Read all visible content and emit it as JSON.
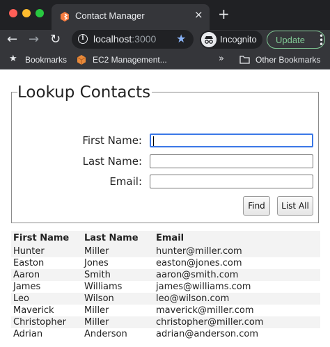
{
  "browser": {
    "tab_title": "Contact Manager",
    "tab_close": "×",
    "new_tab": "+",
    "url_host": "localhost",
    "url_port": ":3000",
    "incognito_label": "Incognito",
    "update_label": "Update",
    "bookmarks": {
      "bookmarks_label": "Bookmarks",
      "ec2_label": "EC2 Management...",
      "overflow": "»",
      "other_label": "Other Bookmarks"
    },
    "colors": {
      "frame": "#202124",
      "toolbar": "#35363a",
      "accent": "#8ab4f8",
      "update": "#81c995"
    }
  },
  "lookup": {
    "legend": "Lookup Contacts",
    "first_name_label": "First Name:",
    "last_name_label": "Last Name:",
    "email_label": "Email:",
    "first_name_value": "",
    "last_name_value": "",
    "email_value": "",
    "find_label": "Find",
    "list_all_label": "List All"
  },
  "results": {
    "headers": [
      "First Name",
      "Last Name",
      "Email"
    ],
    "rows": [
      [
        "Hunter",
        "Miller",
        "hunter@miller.com"
      ],
      [
        "Easton",
        "Jones",
        "easton@jones.com"
      ],
      [
        "Aaron",
        "Smith",
        "aaron@smith.com"
      ],
      [
        "James",
        "Williams",
        "james@williams.com"
      ],
      [
        "Leo",
        "Wilson",
        "leo@wilson.com"
      ],
      [
        "Maverick",
        "Miller",
        "maverick@miller.com"
      ],
      [
        "Christopher",
        "Miller",
        "christopher@miller.com"
      ],
      [
        "Adrian",
        "Anderson",
        "adrian@anderson.com"
      ]
    ]
  }
}
